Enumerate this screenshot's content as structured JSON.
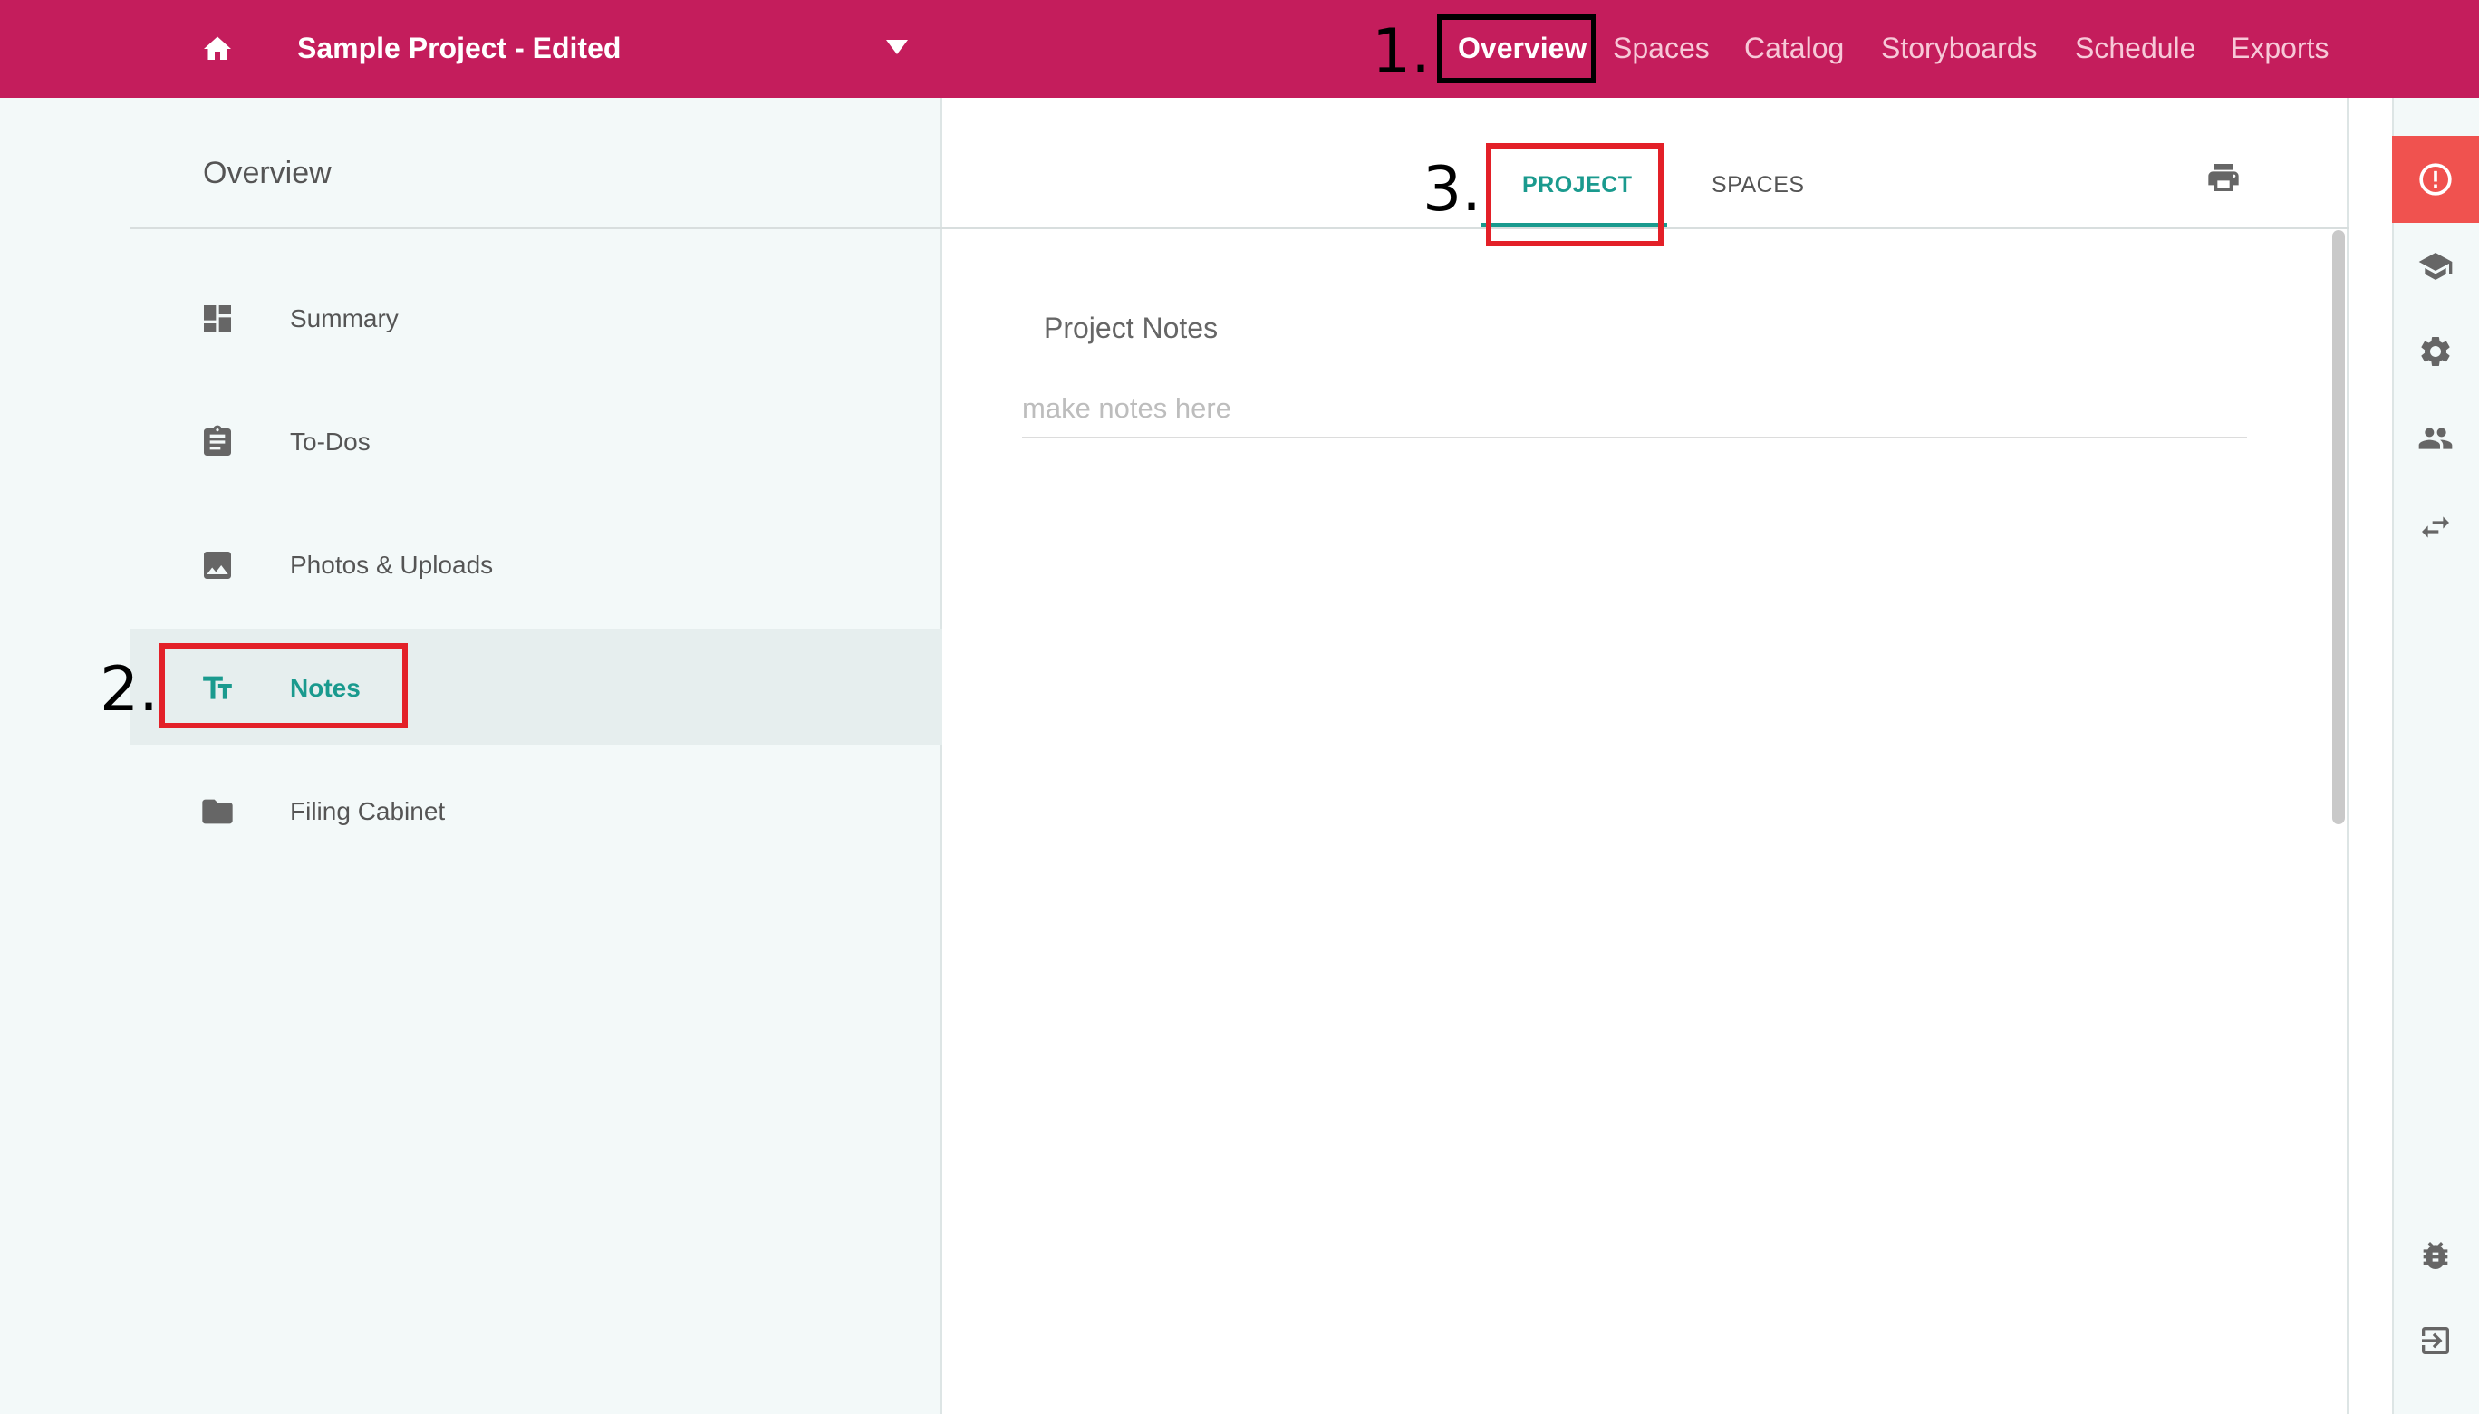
{
  "header": {
    "project_title": "Sample Project - Edited",
    "nav": [
      {
        "label": "Overview",
        "active": true
      },
      {
        "label": "Spaces",
        "active": false
      },
      {
        "label": "Catalog",
        "active": false
      },
      {
        "label": "Storyboards",
        "active": false
      },
      {
        "label": "Schedule",
        "active": false
      },
      {
        "label": "Exports",
        "active": false
      }
    ]
  },
  "annotations": {
    "step1": "1.",
    "step2": "2.",
    "step3": "3."
  },
  "sidebar": {
    "title": "Overview",
    "items": [
      {
        "label": "Summary",
        "icon": "dashboard-icon"
      },
      {
        "label": "To-Dos",
        "icon": "clipboard-icon"
      },
      {
        "label": "Photos & Uploads",
        "icon": "image-icon"
      },
      {
        "label": "Notes",
        "icon": "text-format-icon",
        "active": true
      },
      {
        "label": "Filing Cabinet",
        "icon": "folder-icon"
      }
    ]
  },
  "main": {
    "tabs": [
      {
        "label": "PROJECT",
        "active": true
      },
      {
        "label": "SPACES",
        "active": false
      }
    ],
    "notes_heading": "Project Notes",
    "notes_placeholder": "make notes here",
    "notes_value": ""
  },
  "rail": {
    "icons": [
      "alert-icon",
      "school-icon",
      "settings-icon",
      "people-icon",
      "swap-icon",
      "bug-icon",
      "logout-icon"
    ]
  },
  "colors": {
    "brand": "#c41d5c",
    "accent": "#1a9a8e",
    "alert": "#f0524f",
    "annotation_red": "#e32028"
  }
}
